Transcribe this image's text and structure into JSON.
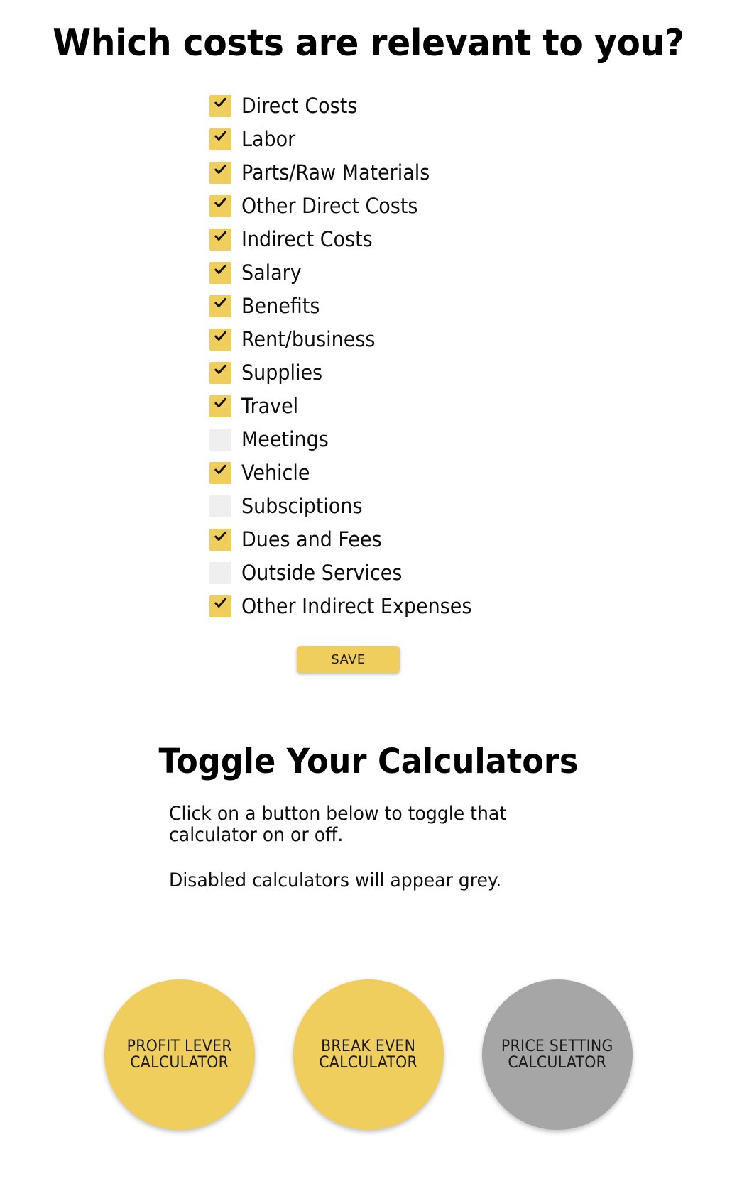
{
  "costs": {
    "title": "Which costs are relevant to you?",
    "items": [
      {
        "label": "Direct Costs",
        "checked": true
      },
      {
        "label": "Labor",
        "checked": true
      },
      {
        "label": "Parts/Raw Materials",
        "checked": true
      },
      {
        "label": "Other Direct Costs",
        "checked": true
      },
      {
        "label": "Indirect Costs",
        "checked": true
      },
      {
        "label": "Salary",
        "checked": true
      },
      {
        "label": "Benefits",
        "checked": true
      },
      {
        "label": "Rent/business",
        "checked": true
      },
      {
        "label": "Supplies",
        "checked": true
      },
      {
        "label": "Travel",
        "checked": true
      },
      {
        "label": "Meetings",
        "checked": false
      },
      {
        "label": "Vehicle",
        "checked": true
      },
      {
        "label": "Subsciptions",
        "checked": false
      },
      {
        "label": "Dues and Fees",
        "checked": true
      },
      {
        "label": "Outside Services",
        "checked": false
      },
      {
        "label": "Other Indirect Expenses",
        "checked": true
      }
    ],
    "save_label": "SAVE"
  },
  "calculators": {
    "title": "Toggle Your Calculators",
    "intro_line_1": "Click on a button below to toggle that calculator on or off.",
    "intro_line_2": "Disabled calculators will appear grey.",
    "buttons": [
      {
        "label": "PROFIT LEVER\nCALCULATOR",
        "enabled": true,
        "name": "profit-lever-calculator-button"
      },
      {
        "label": "BREAK EVEN\nCALCULATOR",
        "enabled": true,
        "name": "break-even-calculator-button"
      },
      {
        "label": "PRICE SETTING\nCALCULATOR",
        "enabled": false,
        "name": "price-setting-calculator-button"
      }
    ]
  },
  "colors": {
    "accent_yellow": "#EFCE5E",
    "disabled_grey": "#A6A6A6",
    "unchecked_box": "#EFEFEF",
    "text_black": "#0D0D0D",
    "background": "#FFFFFF"
  }
}
